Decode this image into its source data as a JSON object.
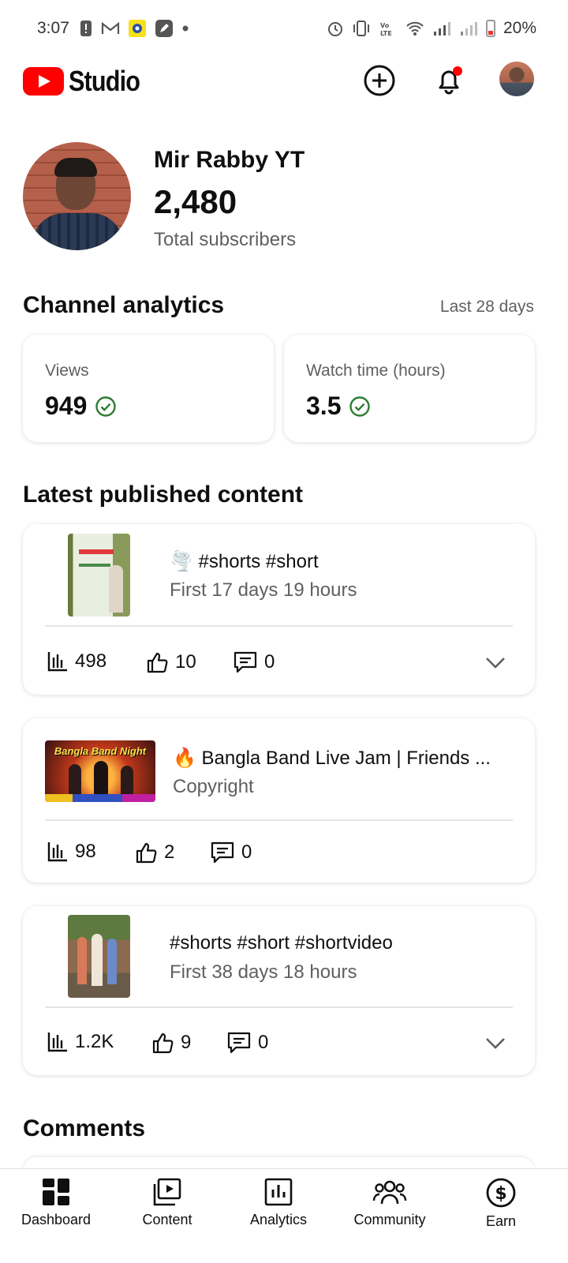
{
  "status_bar": {
    "time": "3:07",
    "battery": "20%"
  },
  "app": {
    "title": "Studio"
  },
  "channel": {
    "name": "Mir Rabby YT",
    "subscribers": "2,480",
    "subscribers_label": "Total subscribers"
  },
  "analytics": {
    "title": "Channel analytics",
    "period": "Last 28 days",
    "views": {
      "label": "Views",
      "value": "949"
    },
    "watch_time": {
      "label": "Watch time (hours)",
      "value": "3.5"
    }
  },
  "latest": {
    "title": "Latest published content",
    "items": [
      {
        "title": "🌪️ #shorts #short",
        "subtitle": "First 17 days 19 hours",
        "views": "498",
        "likes": "10",
        "comments": "0"
      },
      {
        "title": "🔥 Bangla Band Live Jam | Friends ...",
        "subtitle": "Copyright",
        "views": "98",
        "likes": "2",
        "comments": "0",
        "thumb_text": "Bangla Band Night"
      },
      {
        "title": "#shorts #short #shortvideo",
        "subtitle": "First 38 days 18 hours",
        "views": "1.2K",
        "likes": "9",
        "comments": "0"
      }
    ]
  },
  "comments": {
    "title": "Comments"
  },
  "nav": {
    "items": [
      {
        "label": "Dashboard",
        "icon": "dashboard-icon"
      },
      {
        "label": "Content",
        "icon": "content-icon"
      },
      {
        "label": "Analytics",
        "icon": "analytics-icon"
      },
      {
        "label": "Community",
        "icon": "community-icon"
      },
      {
        "label": "Earn",
        "icon": "earn-icon"
      }
    ]
  },
  "colors": {
    "brand_red": "#ff0000",
    "check_green": "#2e7d32",
    "muted_text": "#606060"
  }
}
